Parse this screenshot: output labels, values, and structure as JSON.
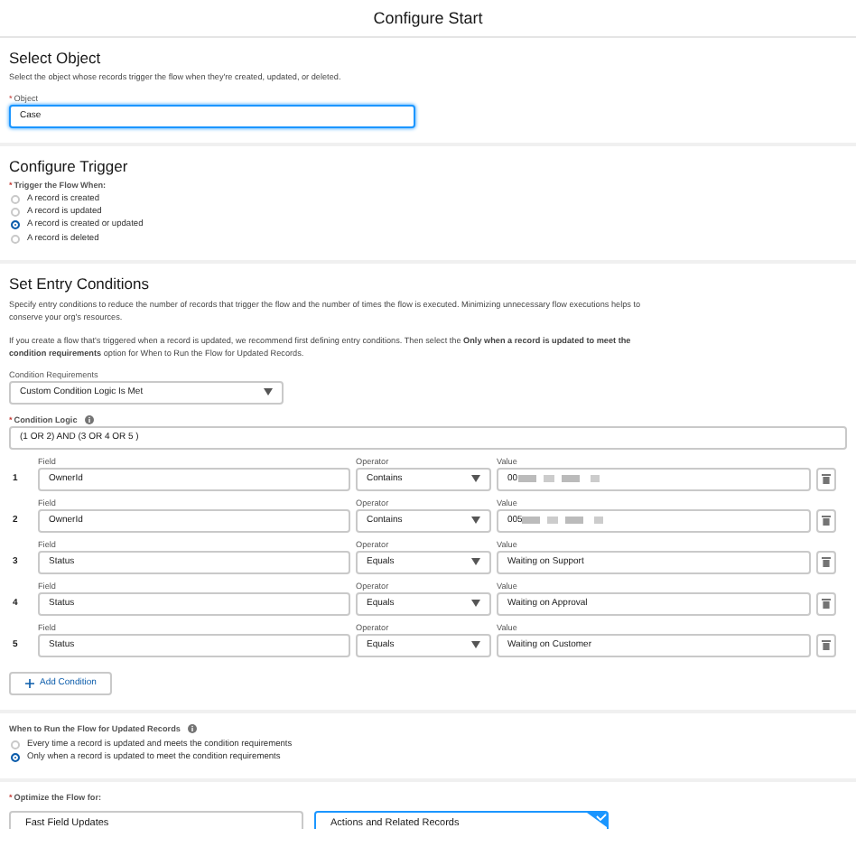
{
  "title": "Configure Start",
  "select_object": {
    "heading": "Select Object",
    "description": "Select the object whose records trigger the flow when they're created, updated, or deleted.",
    "object_label": {
      "mark": "*",
      "text": "Object"
    },
    "object_value": "Case"
  },
  "configure_trigger": {
    "heading": "Configure Trigger",
    "label": {
      "mark": "*",
      "text": "Trigger the Flow When:"
    },
    "options": [
      {
        "label": "A record is created",
        "selected": false
      },
      {
        "label": "A record is updated",
        "selected": false
      },
      {
        "label": "A record is created or updated",
        "selected": true
      },
      {
        "label": "A record is deleted",
        "selected": false
      }
    ]
  },
  "entry_conditions": {
    "heading": "Set Entry Conditions",
    "paragraphs": [
      "Specify entry conditions to reduce the number of records that trigger the flow and the number of times the flow is executed. Minimizing unnecessary flow executions helps to conserve your org's resources.",
      "If you create a flow that's triggered when a record is updated, we recommend first defining entry conditions. Then select the **Only when a record is updated to meet the condition requirements** option for When to Run the Flow for Updated Records."
    ],
    "requirements_label": "Condition Requirements",
    "requirements_value": "Custom Condition Logic Is Met",
    "logic_label": {
      "mark": "*",
      "text": "Condition Logic"
    },
    "logic_value": "(1 OR 2) AND (3 OR 4 OR 5 )",
    "conditions": [
      {
        "number": "1",
        "field_label": "Field",
        "field": "OwnerId",
        "operator_label": "Operator",
        "operator": "Contains",
        "value_label": "Value",
        "value": "00",
        "redacted": true
      },
      {
        "number": "2",
        "field_label": "Field",
        "field": "OwnerId",
        "operator_label": "Operator",
        "operator": "Contains",
        "value_label": "Value",
        "value": "005",
        "redacted": true
      },
      {
        "number": "3",
        "field_label": "Field",
        "field": "Status",
        "operator_label": "Operator",
        "operator": "Equals",
        "value_label": "Value",
        "value": "Waiting on Support",
        "redacted": false
      },
      {
        "number": "4",
        "field_label": "Field",
        "field": "Status",
        "operator_label": "Operator",
        "operator": "Equals",
        "value_label": "Value",
        "value": "Waiting on Approval",
        "redacted": false
      },
      {
        "number": "5",
        "field_label": "Field",
        "field": "Status",
        "operator_label": "Operator",
        "operator": "Equals",
        "value_label": "Value",
        "value": "Waiting on Customer",
        "redacted": false
      }
    ],
    "add_button": "Add Condition"
  },
  "run_when": {
    "label": "When to Run the Flow for Updated Records",
    "options": [
      {
        "label": "Every time a record is updated and meets the condition requirements",
        "selected": false
      },
      {
        "label": "Only when a record is updated to meet the condition requirements",
        "selected": true
      }
    ]
  },
  "optimize": {
    "label": {
      "mark": "*",
      "text": "Optimize the Flow for:"
    },
    "options": [
      {
        "label": "Fast Field Updates",
        "selected": false
      },
      {
        "label": "Actions and Related Records",
        "selected": true
      }
    ]
  }
}
